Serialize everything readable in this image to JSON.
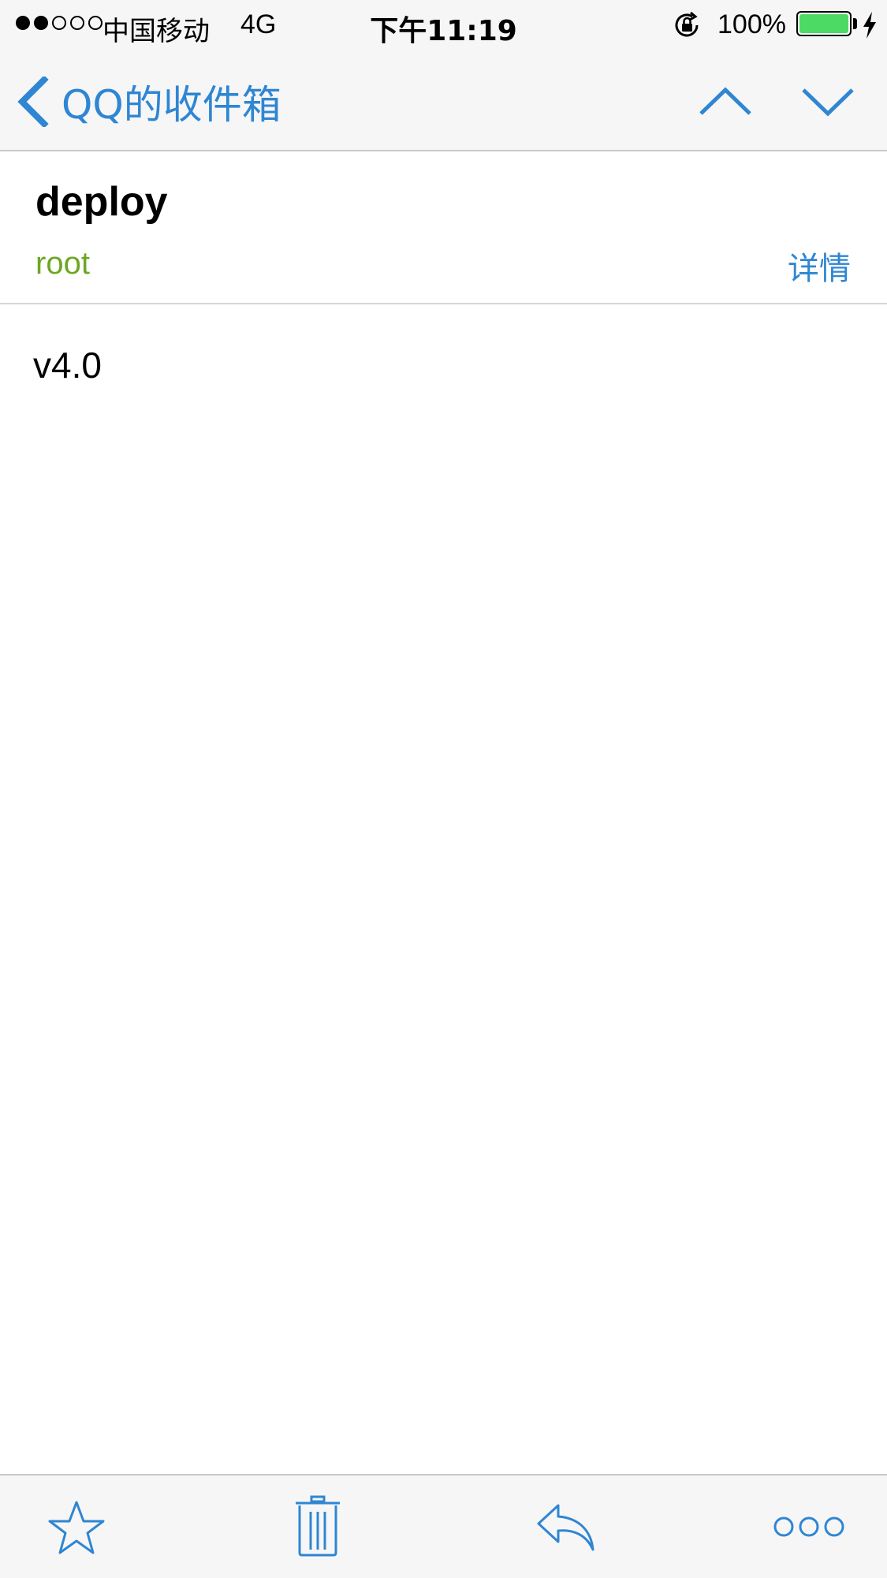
{
  "status_bar": {
    "carrier": "中国移动",
    "network": "4G",
    "time": "下午11:19",
    "battery_percent": "100%",
    "signal_strength": 2,
    "battery_color": "#4cd964"
  },
  "nav": {
    "back_label": "QQ的收件箱",
    "accent_color": "#2f86d2"
  },
  "mail": {
    "subject": "deploy",
    "sender": "root",
    "details_label": "详情",
    "body": "v4.0",
    "sender_color": "#6da722"
  },
  "toolbar": {
    "icons": [
      "star-icon",
      "trash-icon",
      "reply-icon",
      "more-icon"
    ]
  }
}
